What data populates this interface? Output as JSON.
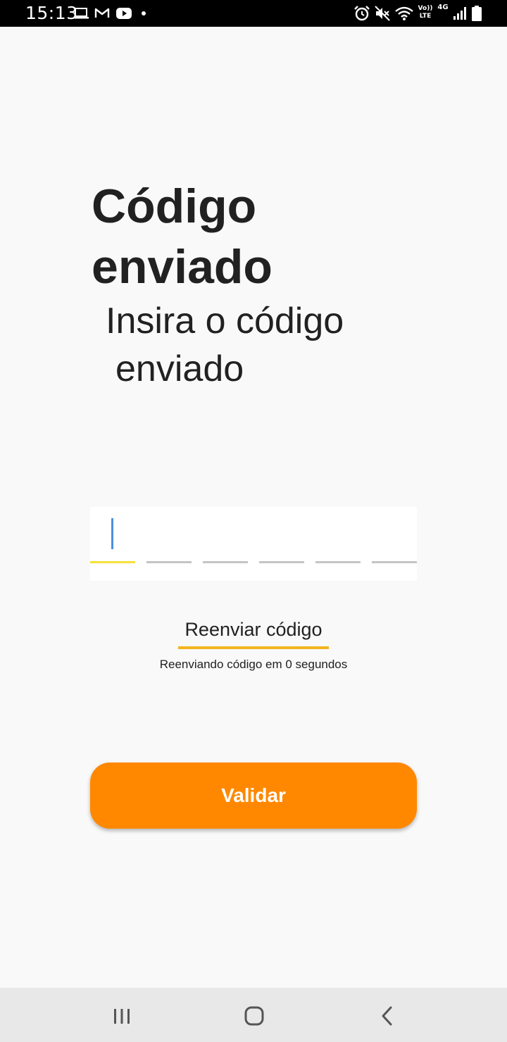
{
  "status_bar": {
    "time": "15:13",
    "volte_label": "Vo)) LTE",
    "network_label": "4G",
    "notification_icons": [
      "laptop-icon",
      "gmail-icon",
      "youtube-icon",
      "dot-icon"
    ],
    "system_icons": [
      "alarm-icon",
      "mute-icon",
      "wifi-icon",
      "volte-icon",
      "4g-icon",
      "signal-icon",
      "battery-icon"
    ]
  },
  "main": {
    "title": "Código enviado",
    "subtitle_line1": "Insira o código",
    "subtitle_line2": "enviado",
    "code_input": {
      "digit_count": 6,
      "values": [
        "",
        "",
        "",
        "",
        "",
        ""
      ],
      "active_index": 0
    },
    "resend_label": "Reenviar código",
    "resend_status": "Reenviando código em 0 segundos",
    "validate_label": "Validar"
  },
  "navigation_bar": {
    "buttons": [
      "recents-icon",
      "home-icon",
      "back-icon"
    ]
  },
  "colors": {
    "background": "#f9f9f9",
    "primary_button": "#ff8800",
    "resend_underline": "#f2b51e",
    "active_cell_underline": "#f5e13a",
    "inactive_cell_underline": "#c4c4c4",
    "caret": "#4a90e2",
    "text": "#212121"
  }
}
